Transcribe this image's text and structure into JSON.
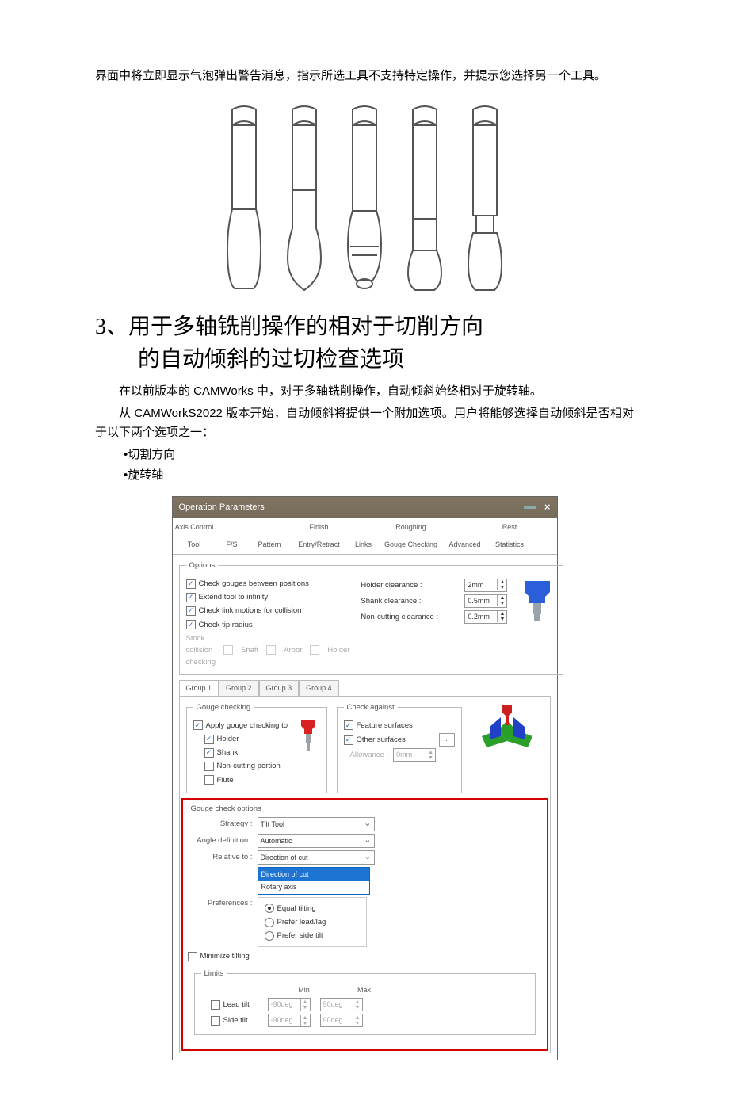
{
  "intro_para": "界面中将立即显示气泡弹出警告消息，指示所选工具不支持特定操作，并提示您选择另一个工具。",
  "heading_l1": "3、用于多轴铣削操作的相对于切削方向",
  "heading_l2": "的自动倾斜的过切检查选项",
  "p1": "在以前版本的 CAMWorks 中，对于多轴铣削操作，自动倾斜始终相对于旋转轴。",
  "p2": "从 CAMWorkS2022 版本开始，自动倾斜将提供一个附加选项。用户将能够选择自动倾斜是否相对于以下两个选项之一：",
  "bullet1": "•切割方向",
  "bullet2": "•旋转轴",
  "dialog": {
    "title": "Operation Parameters",
    "tabs_row1": [
      "Axis Control",
      "",
      "",
      "Finish",
      "",
      "Roughing",
      "",
      "Rest"
    ],
    "tabs_row2": [
      "Tool",
      "F/S",
      "Pattern",
      "Entry/Retract",
      "Links",
      "Gouge Checking",
      "Advanced",
      "Statistics"
    ],
    "options_legend": "Options",
    "opt_cb1": "Check gouges between positions",
    "opt_cb2": "Extend tool to infinity",
    "opt_cb3": "Check link motions for collision",
    "opt_cb4": "Check tip radius",
    "opt_stock": "Stock collision checking",
    "opt_shaft": "Shaft",
    "opt_arbor": "Arbor",
    "opt_holder": "Holder",
    "lbl_holder_clear": "Holder clearance :",
    "val_holder_clear": "2mm",
    "lbl_shank_clear": "Shank clearance :",
    "val_shank_clear": "0.5mm",
    "lbl_noncut_clear": "Non-cutting clearance :",
    "val_noncut_clear": "0.2mm",
    "gtab1": "Group 1",
    "gtab2": "Group 2",
    "gtab3": "Group 3",
    "gtab4": "Group 4",
    "gc_legend": "Gouge checking",
    "gc_apply": "Apply gouge checking to",
    "gc_holder": "Holder",
    "gc_shank": "Shank",
    "gc_noncut": "Non-cutting portion",
    "gc_flute": "Flute",
    "ca_legend": "Check against",
    "ca_feat": "Feature surfaces",
    "ca_other": "Other surfaces",
    "ca_btn": "...",
    "ca_allow": "Allowance :",
    "ca_allow_val": "0mm",
    "gco_legend": "Gouge check options",
    "lbl_strategy": "Strategy :",
    "val_strategy": "Tilt Tool",
    "lbl_angledef": "Angle definition :",
    "val_angledef": "Automatic",
    "lbl_relative": "Relative to :",
    "val_relative": "Direction of cut",
    "dd_opt1": "Direction of cut",
    "dd_opt2": "Rotary axis",
    "lbl_pref": "Preferences :",
    "pref_eq": "Equal tilting",
    "pref_lead": "Prefer lead/lag",
    "pref_side": "Prefer side tilt",
    "cb_minimize": "Minimize tilting",
    "lim_legend": "Limits",
    "lim_min": "Min",
    "lim_max": "Max",
    "lim_lead": "Lead tilt",
    "lim_side": "Side tilt",
    "lim_lead_min": "-90deg",
    "lim_lead_max": "90deg",
    "lim_side_min": "-90deg",
    "lim_side_max": "90deg"
  }
}
